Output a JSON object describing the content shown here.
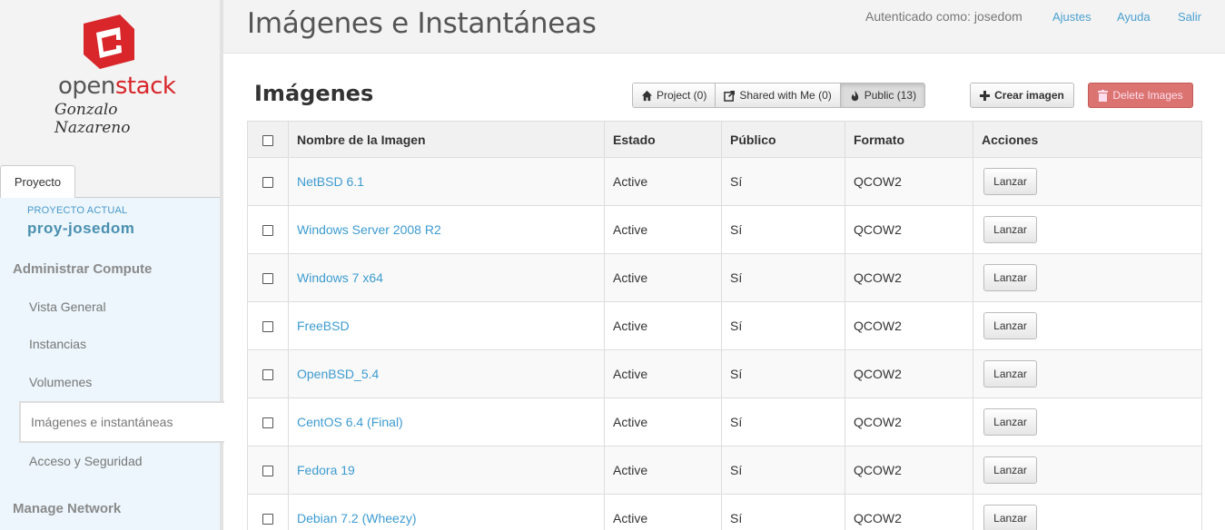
{
  "brand": {
    "name_part1": "open",
    "name_part2": "stack",
    "subtitle": "Gonzalo Nazareno",
    "logo_color": "#d8262b"
  },
  "header": {
    "title": "Imágenes e Instantáneas",
    "auth_text": "Autenticado como: josedom",
    "links": {
      "settings": "Ajustes",
      "help": "Ayuda",
      "logout": "Salir"
    }
  },
  "sidebar": {
    "tab": "Proyecto",
    "current_project_label": "PROYECTO ACTUAL",
    "current_project": "proy-josedom",
    "section_compute": "Administrar Compute",
    "items": {
      "overview": "Vista General",
      "instances": "Instancias",
      "volumes": "Volumenes",
      "images": "Imágenes e instantáneas",
      "access": "Acceso y Seguridad"
    },
    "section_network": "Manage Network"
  },
  "main": {
    "section_title": "Imágenes",
    "filters": {
      "project": "Project (0)",
      "shared": "Shared with Me (0)",
      "public": "Public (13)"
    },
    "create_button": "Crear imagen",
    "delete_button": "Delete Images"
  },
  "table": {
    "headers": {
      "name": "Nombre de la Imagen",
      "status": "Estado",
      "public": "Público",
      "format": "Formato",
      "actions": "Acciones"
    },
    "launch_label": "Lanzar",
    "rows": [
      {
        "name": "NetBSD 6.1",
        "status": "Active",
        "public": "Sí",
        "format": "QCOW2"
      },
      {
        "name": "Windows Server 2008 R2",
        "status": "Active",
        "public": "Sí",
        "format": "QCOW2"
      },
      {
        "name": "Windows 7 x64",
        "status": "Active",
        "public": "Sí",
        "format": "QCOW2"
      },
      {
        "name": "FreeBSD",
        "status": "Active",
        "public": "Sí",
        "format": "QCOW2"
      },
      {
        "name": "OpenBSD_5.4",
        "status": "Active",
        "public": "Sí",
        "format": "QCOW2"
      },
      {
        "name": "CentOS 6.4 (Final)",
        "status": "Active",
        "public": "Sí",
        "format": "QCOW2"
      },
      {
        "name": "Fedora 19",
        "status": "Active",
        "public": "Sí",
        "format": "QCOW2"
      },
      {
        "name": "Debian 7.2 (Wheezy)",
        "status": "Active",
        "public": "Sí",
        "format": "QCOW2"
      }
    ]
  }
}
